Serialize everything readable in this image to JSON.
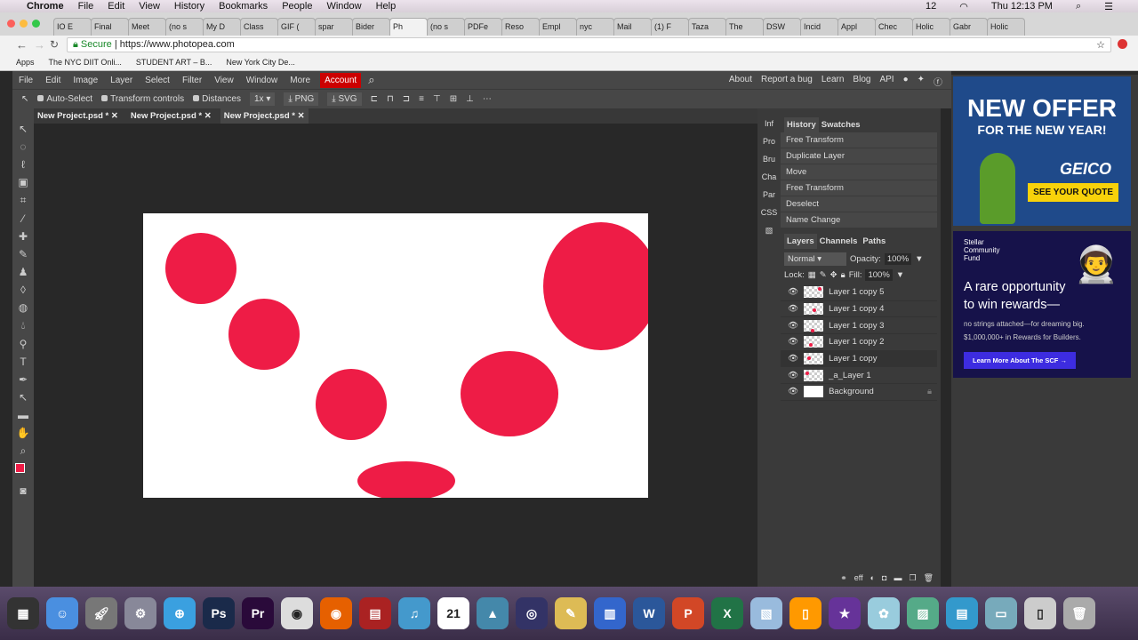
{
  "mac": {
    "apple": "",
    "app": "Chrome",
    "menus": [
      "File",
      "Edit",
      "View",
      "History",
      "Bookmarks",
      "People",
      "Window",
      "Help"
    ],
    "status": [
      "12",
      "Thu 12:13 PM"
    ]
  },
  "browser": {
    "tabs": [
      "IO E",
      "Final",
      "Meet",
      "(no s",
      "My D",
      "Class",
      "GIF (",
      "spar",
      "Bider",
      "Ph",
      "(no s",
      "PDFe",
      "Reso",
      "Empl",
      "nyc",
      "Mail",
      "(1) F",
      "Taza",
      "The",
      "DSW",
      "Incid",
      "Appl",
      "Chec",
      "Holic",
      "Gabr",
      "Holic"
    ],
    "active_tab": 9,
    "secure": "Secure",
    "url": "https://www.photopea.com",
    "bookmarks": [
      "Apps",
      "The NYC DIIT Onli...",
      "STUDENT ART – B...",
      "New York City De..."
    ]
  },
  "pp": {
    "menu": [
      "File",
      "Edit",
      "Image",
      "Layer",
      "Select",
      "Filter",
      "View",
      "Window",
      "More"
    ],
    "account": "Account",
    "links": [
      "About",
      "Report a bug",
      "Learn",
      "Blog",
      "API"
    ],
    "options": {
      "auto_select": "Auto-Select",
      "transform": "Transform controls",
      "distances": "Distances",
      "scale": "1x",
      "png": "PNG",
      "svg": "SVG"
    },
    "doc_tabs": [
      "New Project.psd *",
      "New Project.psd *",
      "New Project.psd *"
    ],
    "side": [
      "Inf",
      "Pro",
      "Bru",
      "Cha",
      "Par",
      "CSS"
    ],
    "history_tabs": [
      "History",
      "Swatches"
    ],
    "history": [
      "Free Transform",
      "Duplicate Layer",
      "Move",
      "Free Transform",
      "Deselect",
      "Name Change"
    ],
    "layer_tabs": [
      "Layers",
      "Channels",
      "Paths"
    ],
    "blend": "Normal",
    "opacity_label": "Opacity:",
    "opacity": "100%",
    "lock_label": "Lock:",
    "fill_label": "Fill:",
    "fill": "100%",
    "layers": [
      "Layer 1 copy 5",
      "Layer 1 copy 4",
      "Layer 1 copy 3",
      "Layer 1 copy 2",
      "Layer 1 copy",
      "_a_Layer 1",
      "Background"
    ],
    "footer_eff": "eff",
    "fg_color": "#ee1c46"
  },
  "ads": {
    "geico": {
      "line1": "NEW OFFER",
      "line2": "FOR THE NEW YEAR!",
      "brand": "GEICO",
      "cta": "SEE YOUR QUOTE"
    },
    "scf": {
      "brand": "Stellar Community Fund",
      "headline": "A rare opportunity to win rewards—",
      "sub": "no strings attached—for dreaming big.",
      "sub2": "$1,000,000+ in Rewards for Builders.",
      "cta": "Learn More About The SCF →"
    }
  }
}
